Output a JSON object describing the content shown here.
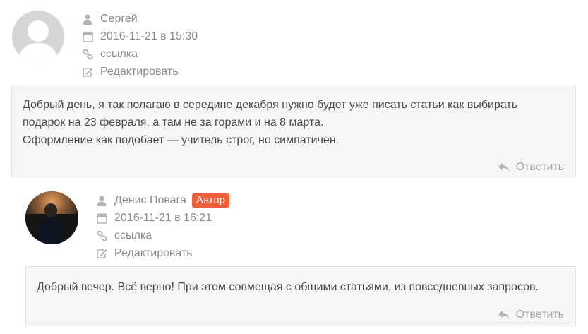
{
  "comments": [
    {
      "author": "Сергей",
      "date": "2016-11-21 в 15:30",
      "link_label": "ссылка",
      "edit_label": "Редактировать",
      "text_lines": [
        "Добрый день, я так полагаю в середине декабря нужно будет уже писать статьи как выбирать",
        "подарок на 23 февраля, а там не за горами и на 8 марта.",
        "Оформление как подобает — учитель строг, но симпатичен."
      ],
      "reply_label": "Ответить"
    },
    {
      "author": "Денис Повага",
      "badge": "Автор",
      "date": "2016-11-21 в 16:21",
      "link_label": "ссылка",
      "edit_label": "Редактировать",
      "text_lines": [
        "Добрый вечер. Всё верно! При этом совмещая с общими статьями, из повседневных запросов."
      ],
      "reply_label": "Ответить"
    }
  ],
  "colors": {
    "badge": "#f25f3a",
    "meta_text": "#8a8a8a",
    "box_bg": "#f6f6f6"
  },
  "icons": [
    "user-icon",
    "calendar-icon",
    "link-icon",
    "edit-icon",
    "reply-icon"
  ]
}
